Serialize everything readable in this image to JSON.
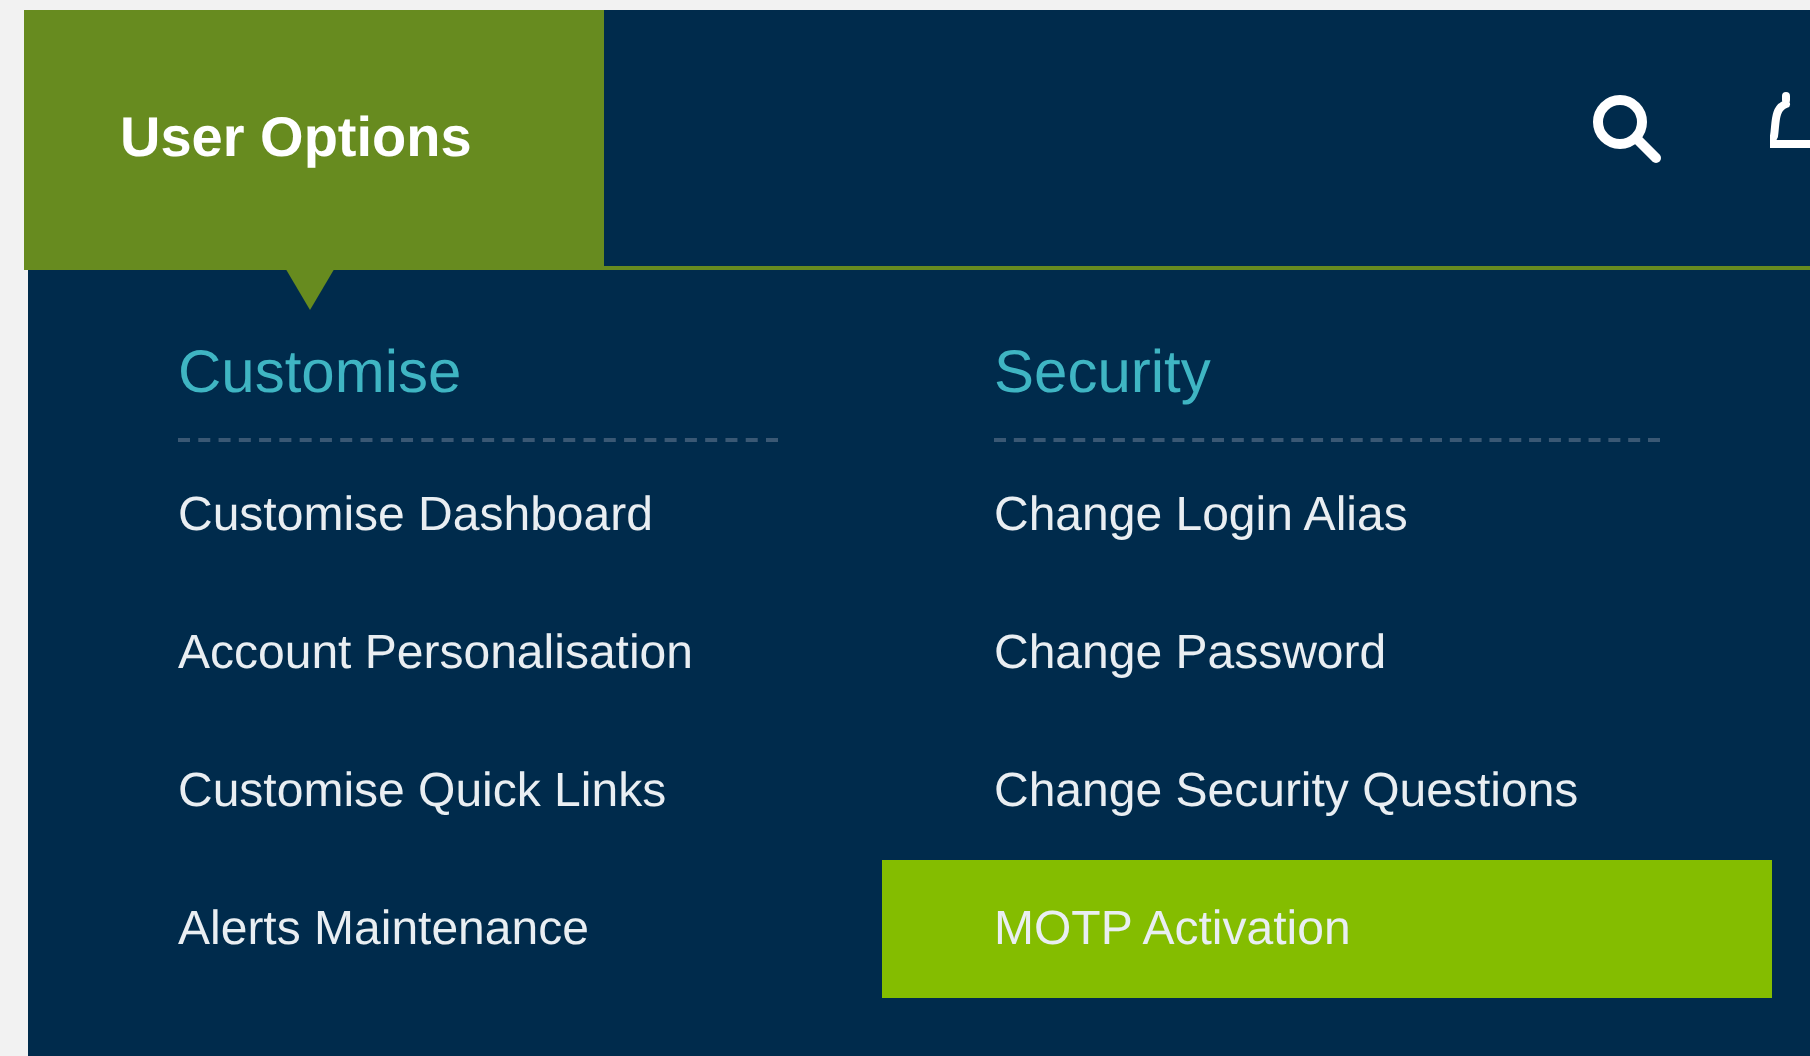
{
  "header": {
    "tab": {
      "label": "User Options",
      "selected": true
    }
  },
  "menu": {
    "columns": [
      {
        "heading": "Customise",
        "items": [
          {
            "label": "Customise Dashboard",
            "selected": false
          },
          {
            "label": "Account Personalisation",
            "selected": false
          },
          {
            "label": "Customise Quick Links",
            "selected": false
          },
          {
            "label": "Alerts Maintenance",
            "selected": false
          }
        ]
      },
      {
        "heading": "Security",
        "items": [
          {
            "label": "Change Login Alias",
            "selected": false
          },
          {
            "label": "Change Password",
            "selected": false
          },
          {
            "label": "Change Security Questions",
            "selected": false
          },
          {
            "label": "MOTP Activation",
            "selected": true
          }
        ]
      }
    ]
  }
}
